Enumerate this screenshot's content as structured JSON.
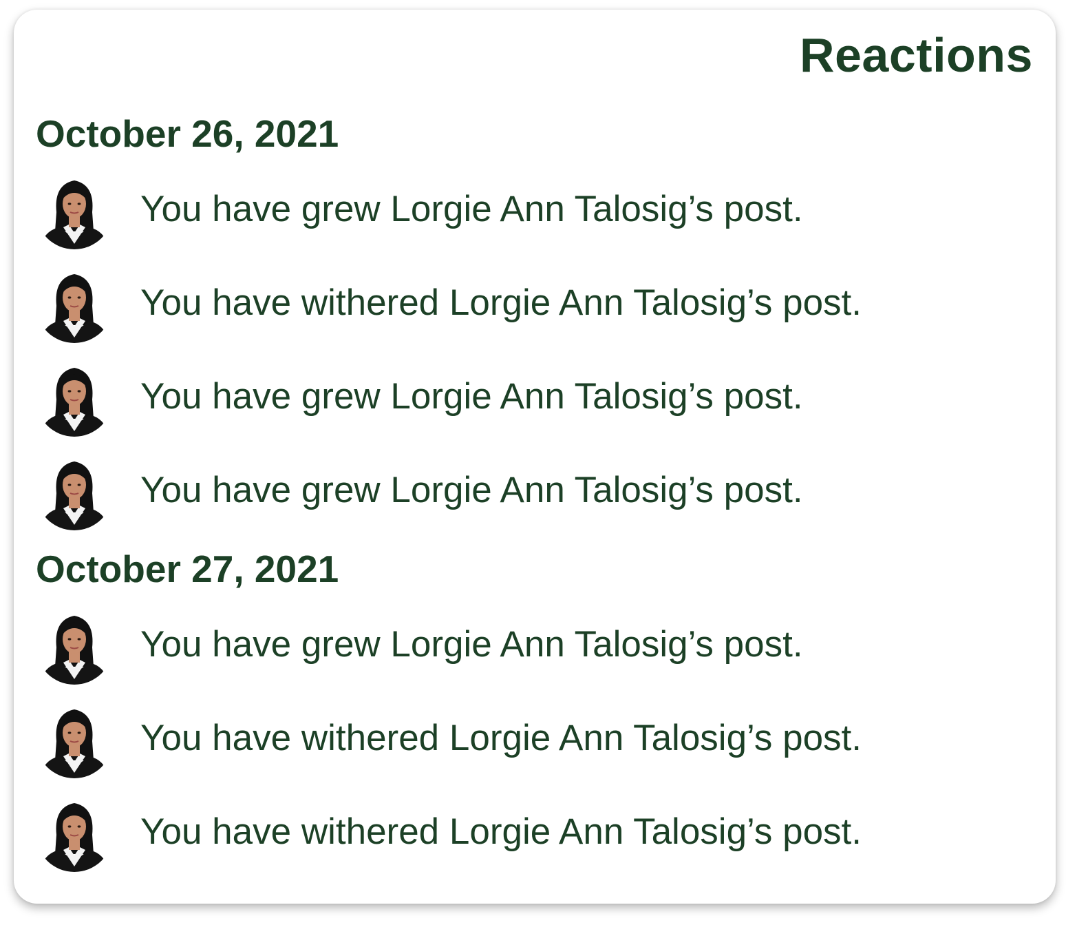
{
  "theme": {
    "text_color": "#1c4026",
    "hair_color": "#111111",
    "skin_color": "#c98f6f",
    "jacket_color": "#141414",
    "shirt_color": "#f3f3f3"
  },
  "panel": {
    "title": "Reactions"
  },
  "groups": [
    {
      "date": "October 26, 2021",
      "items": [
        {
          "avatar_icon": "user-photo-avatar",
          "text": "You have grew Lorgie Ann Talosig’s post."
        },
        {
          "avatar_icon": "user-photo-avatar",
          "text": "You have withered Lorgie Ann Talosig’s post."
        },
        {
          "avatar_icon": "user-photo-avatar",
          "text": "You have grew Lorgie Ann Talosig’s post."
        },
        {
          "avatar_icon": "user-photo-avatar",
          "text": "You have grew Lorgie Ann Talosig’s post."
        }
      ]
    },
    {
      "date": "October 27, 2021",
      "items": [
        {
          "avatar_icon": "user-photo-avatar",
          "text": "You have grew Lorgie Ann Talosig’s post."
        },
        {
          "avatar_icon": "user-photo-avatar",
          "text": "You have withered Lorgie Ann Talosig’s post."
        },
        {
          "avatar_icon": "user-photo-avatar",
          "text": "You have withered Lorgie Ann Talosig’s post."
        }
      ]
    }
  ]
}
